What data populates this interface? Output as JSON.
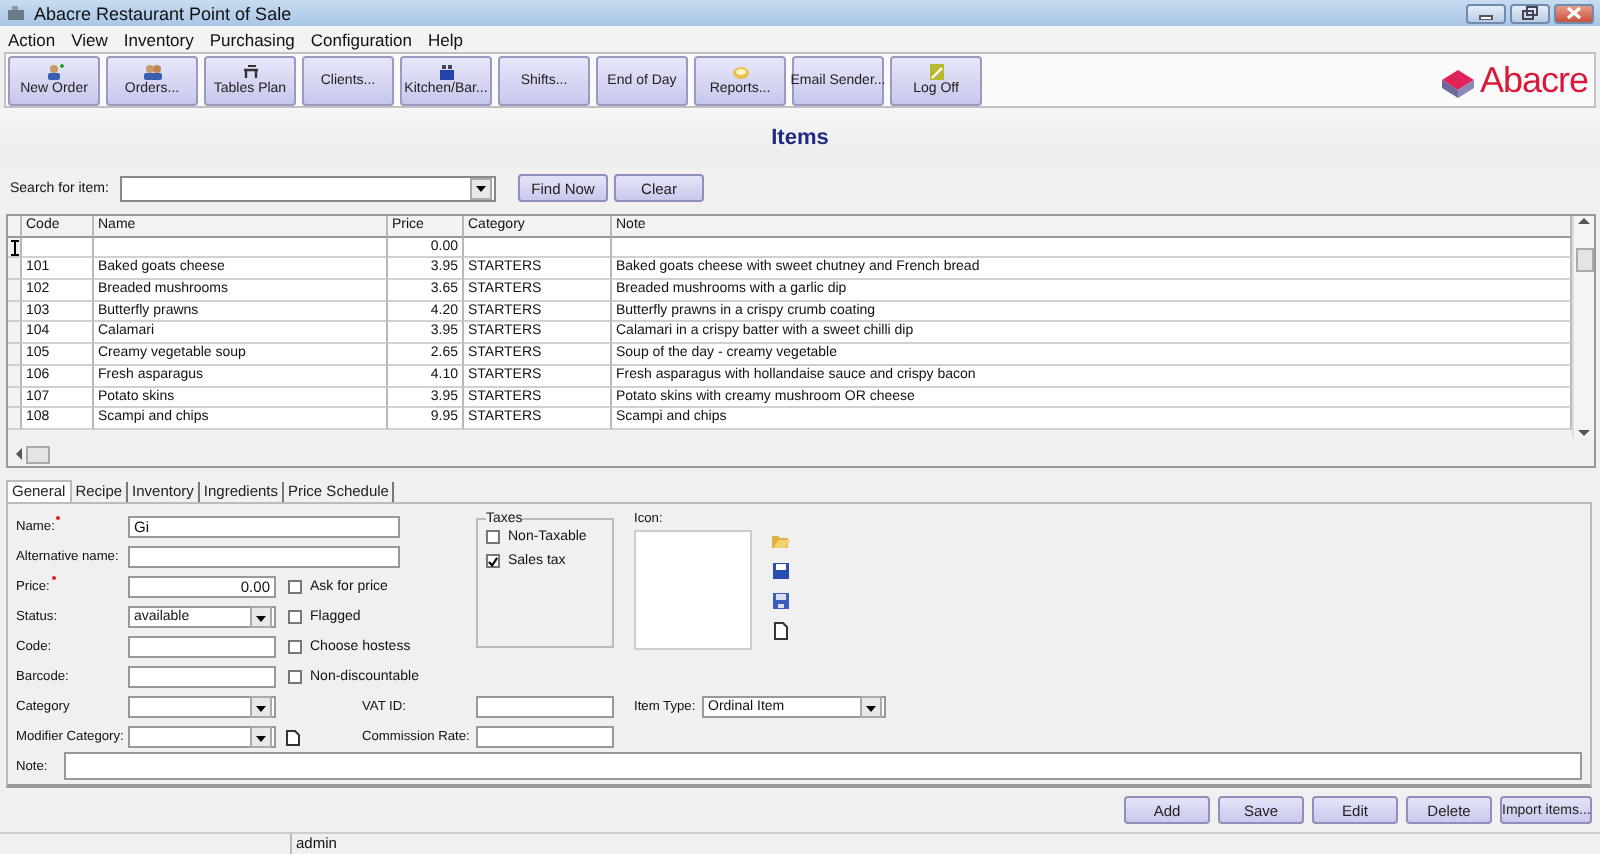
{
  "window": {
    "title": "Abacre Restaurant Point of Sale"
  },
  "menu": [
    "Action",
    "View",
    "Inventory",
    "Purchasing",
    "Configuration",
    "Help"
  ],
  "toolbar": [
    {
      "label": "New Order",
      "kind": "personadd"
    },
    {
      "label": "Orders...",
      "kind": "people"
    },
    {
      "label": "Tables Plan",
      "kind": "table"
    },
    {
      "label": "Clients...",
      "kind": "plain"
    },
    {
      "label": "Kitchen/Bar...",
      "kind": "kitchen"
    },
    {
      "label": "Shifts...",
      "kind": "plain"
    },
    {
      "label": "End of Day",
      "kind": "plain"
    },
    {
      "label": "Reports...",
      "kind": "reports"
    },
    {
      "label": "Email Sender...",
      "kind": "plain"
    },
    {
      "label": "Log Off",
      "kind": "pencil"
    }
  ],
  "logo": {
    "text": "Abacre"
  },
  "heading": "Items",
  "search": {
    "label": "Search for item:",
    "buttons": [
      "Find Now",
      "Clear"
    ]
  },
  "table": {
    "columns": [
      "Code",
      "Name",
      "Price",
      "Category",
      "Note"
    ],
    "rows": [
      {
        "current": true,
        "cells": [
          "",
          "",
          "0.00",
          "",
          ""
        ]
      },
      {
        "current": false,
        "cells": [
          "101",
          "Baked goats cheese",
          "3.95",
          "STARTERS",
          "Baked goats cheese with sweet chutney and French bread"
        ]
      },
      {
        "current": false,
        "cells": [
          "102",
          "Breaded mushrooms",
          "3.65",
          "STARTERS",
          "Breaded mushrooms with a garlic dip"
        ]
      },
      {
        "current": false,
        "cells": [
          "103",
          "Butterfly prawns",
          "4.20",
          "STARTERS",
          "Butterfly prawns in a crispy crumb coating"
        ]
      },
      {
        "current": false,
        "cells": [
          "104",
          "Calamari",
          "3.95",
          "STARTERS",
          "Calamari in a crispy batter with a sweet chilli dip"
        ]
      },
      {
        "current": false,
        "cells": [
          "105",
          "Creamy vegetable soup",
          "2.65",
          "STARTERS",
          "Soup of the day - creamy vegetable"
        ]
      },
      {
        "current": false,
        "cells": [
          "106",
          "Fresh asparagus",
          "4.10",
          "STARTERS",
          "Fresh asparagus with hollandaise sauce and crispy bacon"
        ]
      },
      {
        "current": false,
        "cells": [
          "107",
          "Potato skins",
          "3.95",
          "STARTERS",
          "Potato skins with creamy mushroom OR cheese"
        ]
      },
      {
        "current": false,
        "cells": [
          "108",
          "Scampi and chips",
          "9.95",
          "STARTERS",
          "Scampi and chips"
        ]
      }
    ]
  },
  "tabs": [
    {
      "label": "General",
      "selected": true
    },
    {
      "label": "Recipe",
      "selected": false
    },
    {
      "label": "Inventory",
      "selected": false
    },
    {
      "label": "Ingredients",
      "selected": false
    },
    {
      "label": "Price Schedule",
      "selected": false
    }
  ],
  "form": {
    "name": {
      "label": "Name:",
      "required": true,
      "value": "Gi"
    },
    "alternative_name": {
      "label": "Alternative name:",
      "required": false
    },
    "price": {
      "label": "Price:",
      "required": true,
      "value": "0.00"
    },
    "status": {
      "label": "Status:",
      "required": false,
      "value": "available"
    },
    "code": {
      "label": "Code:",
      "required": false
    },
    "barcode": {
      "label": "Barcode:",
      "required": false
    },
    "category": {
      "label": "Category",
      "required": false
    },
    "modifier_category": {
      "label": "Modifier Category:",
      "required": false
    },
    "options": [
      {
        "label": "Ask for price",
        "checked": false
      },
      {
        "label": "Flagged",
        "checked": false
      },
      {
        "label": "Choose hostess",
        "checked": false
      },
      {
        "label": "Non-discountable",
        "checked": false
      }
    ],
    "taxes": {
      "title": "Taxes",
      "options": [
        {
          "label": "Non-Taxable",
          "checked": false
        },
        {
          "label": "Sales tax",
          "checked": true
        }
      ]
    },
    "icon": {
      "label": "Icon:"
    },
    "vat_id": {
      "label": "VAT ID:"
    },
    "commission_rate": {
      "label": "Commission Rate:"
    },
    "item_type": {
      "label": "Item Type:",
      "value": "Ordinal Item"
    },
    "note": {
      "label": "Note:"
    }
  },
  "actions": [
    "Add",
    "Save",
    "Edit",
    "Delete",
    "Import items..."
  ],
  "status_bar": {
    "user": "admin"
  }
}
